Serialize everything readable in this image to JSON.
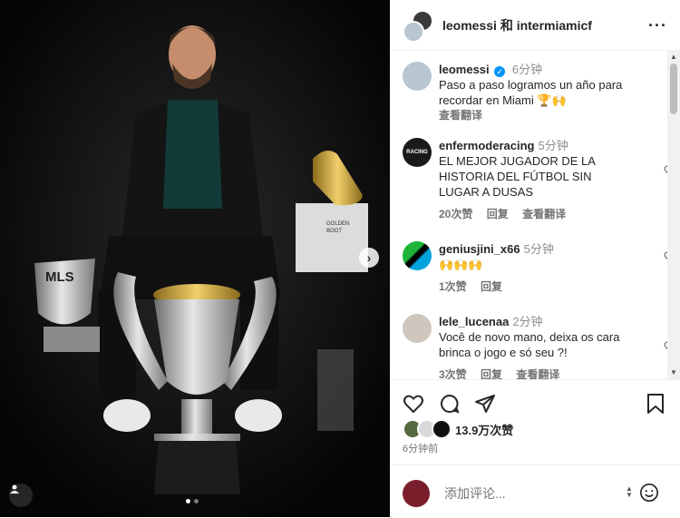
{
  "header": {
    "title": "leomessi 和 intermiamicf"
  },
  "caption": {
    "user": "leomessi",
    "verified_mark": "✓",
    "time": "6分钟",
    "text": "Paso a paso logramos un año para recordar en Miami 🏆🙌",
    "translate": "查看翻译"
  },
  "comments": [
    {
      "user": "enfermoderacing",
      "time": "5分钟",
      "text": "EL MEJOR JUGADOR DE LA HISTORIA DEL FÚTBOL SIN LUGAR A DUSAS",
      "likes": "20次赞",
      "reply": "回复",
      "translate": "查看翻译",
      "avatar_label": "RACING"
    },
    {
      "user": "geniusjini_x66",
      "time": "5分钟",
      "text": "🙌🙌🙌",
      "likes": "1次赞",
      "reply": "回复"
    },
    {
      "user": "lele_lucenaa",
      "time": "2分钟",
      "text": "Você de novo mano, deixa os cara brinca o jogo e só seu ?!",
      "likes": "3次赞",
      "reply": "回复",
      "translate": "查看翻译"
    }
  ],
  "stats": {
    "likes_text": "13.9万次赞",
    "post_time": "6分钟前"
  },
  "add_comment": {
    "placeholder": "添加评论..."
  },
  "photo": {
    "mls_text": "MLS",
    "box_text_1": "GOLDEN",
    "box_text_2": "BOOT"
  },
  "colors": {
    "accent": "#0095f6",
    "muted": "#737373",
    "text": "#262626"
  }
}
